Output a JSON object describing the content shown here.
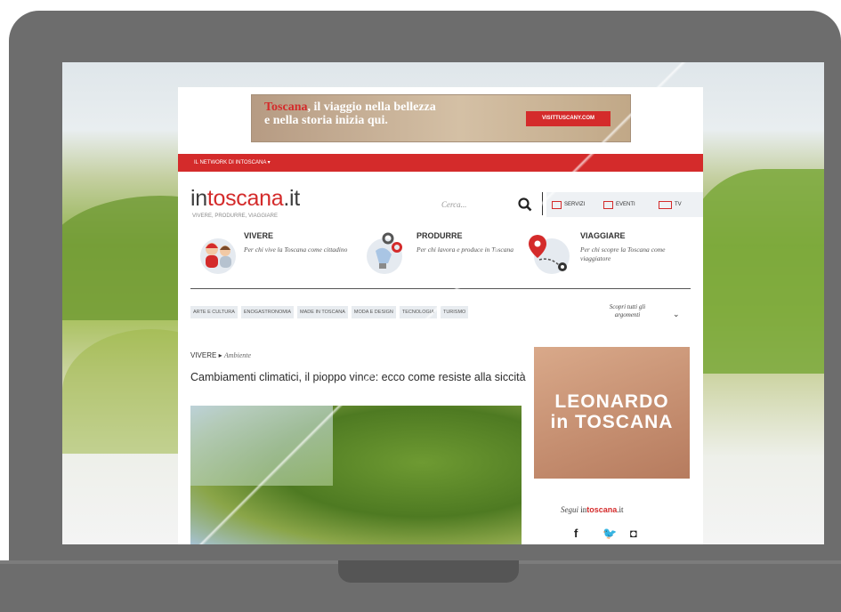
{
  "ad": {
    "brand": "Toscana",
    "line1": ", il viaggio nella bellezza",
    "line2": "e nella storia inizia qui.",
    "button": "VISITTUSCANY.COM"
  },
  "network": {
    "label": "IL NETWORK DI INTOSCANA ▾"
  },
  "logo": {
    "prefix": "in",
    "brand": "toscana",
    "suffix": ".it",
    "tagline": "VIVERE, PRODURRE, VIAGGIARE"
  },
  "search": {
    "placeholder": "Cerca..."
  },
  "services": [
    {
      "label": "SERVIZI"
    },
    {
      "label": "EVENTI"
    },
    {
      "label": "TV"
    }
  ],
  "categories": [
    {
      "title": "VIVERE",
      "desc": "Per chi vive la Toscana come cittadino"
    },
    {
      "title": "PRODURRE",
      "desc": "Per chi lavora e produce in Toscana"
    },
    {
      "title": "VIAGGIARE",
      "desc": "Per chi scopre la Toscana come viaggiatore"
    }
  ],
  "tags": [
    "ARTE E CULTURA",
    "ENOGASTRONOMIA",
    "MADE IN TOSCANA",
    "MODA E DESIGN",
    "TECNOLOGIA",
    "TURISMO"
  ],
  "scopri": "Scopri tutti gli argomenti",
  "breadcrumb": {
    "section": "VIVERE",
    "sub": "Ambiente"
  },
  "article": {
    "title": "Cambiamenti climatici, il pioppo vince: ecco come resiste alla siccità"
  },
  "banner": {
    "line1": "LEONARDO",
    "line2": "in TOSCANA"
  },
  "follow": {
    "label": "Segui",
    "brand_in": "in",
    "brand": "toscana",
    "brand_suffix": ".it"
  },
  "social": [
    "f",
    "🐦",
    "◘"
  ],
  "colors": {
    "accent": "#d42b2b",
    "frame": "#6d6d6d"
  }
}
